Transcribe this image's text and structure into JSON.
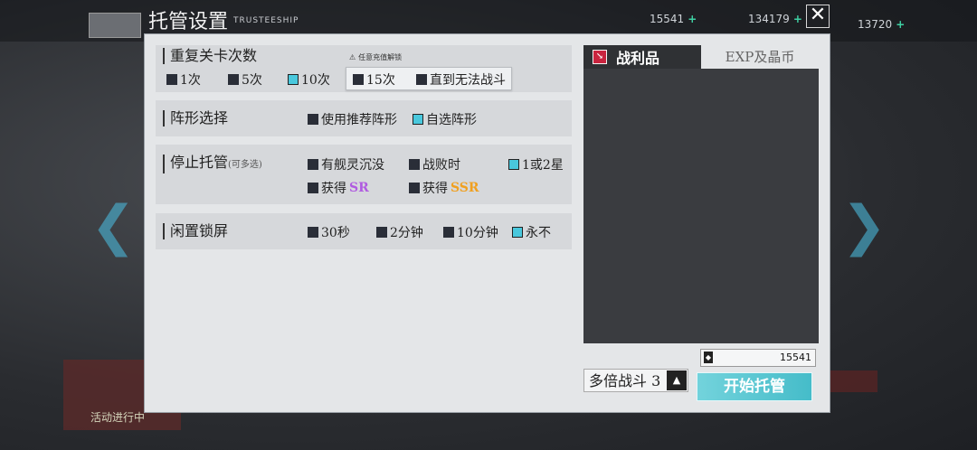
{
  "background": {
    "stats": [
      "15541",
      "134179",
      "13720"
    ],
    "event_label": "活动进行中"
  },
  "dialog": {
    "title": "托管设置",
    "title_sub": "TRUSTEESHIP"
  },
  "repeat": {
    "title": "重复关卡次数",
    "hint": "任意充值解锁",
    "options": [
      "1次",
      "5次",
      "10次",
      "15次",
      "直到无法战斗"
    ],
    "selected": "10次"
  },
  "formation": {
    "title": "阵形选择",
    "options": [
      "使用推荐阵形",
      "自选阵形"
    ],
    "selected": "自选阵形"
  },
  "stop": {
    "title": "停止托管",
    "title_sub": "(可多选)",
    "options": [
      "有舰灵沉没",
      "战败时",
      "1或2星"
    ],
    "get_prefix": "获得",
    "sr": "SR",
    "ssr": "SSR",
    "selected": [
      "1或2星"
    ]
  },
  "idle": {
    "title": "闲置锁屏",
    "options": [
      "30秒",
      "2分钟",
      "10分钟",
      "永不"
    ],
    "selected": "永不"
  },
  "right": {
    "tab_loot": "战利品",
    "tab_exp": "EXP及晶币",
    "coin_value": "15541",
    "multi_label": "多倍战斗",
    "multi_value": "3",
    "start_label": "开始托管"
  }
}
